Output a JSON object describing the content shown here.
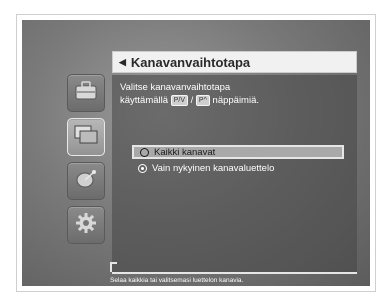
{
  "dialog": {
    "title": "Kanavanvaihtotapa",
    "description_line1": "Valitse kanavanvaihtotapa",
    "description_prefix": "käyttämällä",
    "key1": "P/V",
    "separator": "/",
    "key2": "P^",
    "description_suffix": "näppäimiä.",
    "options": [
      {
        "label": "Kaikki kanavat",
        "selected": false,
        "highlighted": true
      },
      {
        "label": "Vain nykyinen kanavaluettelo",
        "selected": true,
        "highlighted": false
      }
    ]
  },
  "sidebar": {
    "icons": [
      "briefcase-icon",
      "screens-icon",
      "satellite-dish-icon",
      "gear-icon"
    ],
    "active_index": 1
  },
  "status_text": "Selaa kaikkia tai valitsemasi luettelon kanavia."
}
